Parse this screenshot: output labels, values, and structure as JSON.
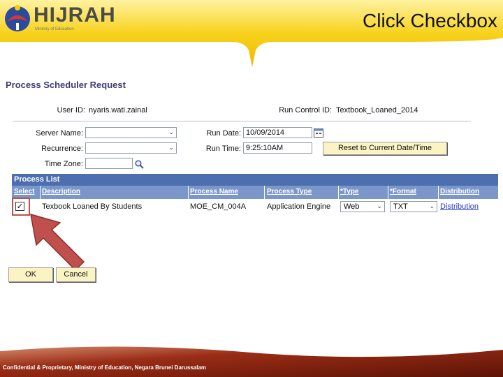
{
  "slide": {
    "title": "Click Checkbox"
  },
  "brand": {
    "logo_text": "HIJRAH",
    "logo_sub": "Ministry of Education"
  },
  "form": {
    "page_title": "Process Scheduler Request",
    "user_id_label": "User ID:",
    "user_id_value": "nyaris.wati.zainal",
    "run_control_label": "Run Control ID:",
    "run_control_value": "Textbook_Loaned_2014",
    "server_name_label": "Server Name:",
    "recurrence_label": "Recurrence:",
    "time_zone_label": "Time Zone:",
    "run_date_label": "Run Date:",
    "run_date_value": "10/09/2014",
    "run_time_label": "Run Time:",
    "run_time_value": "9:25:10AM",
    "reset_button": "Reset to Current Date/Time"
  },
  "process_list": {
    "title": "Process List",
    "columns": [
      "Select",
      "Description",
      "Process Name",
      "Process Type",
      "*Type",
      "*Format",
      "Distribution"
    ],
    "rows": [
      {
        "select": "✓",
        "description": "Texbook Loaned By Students",
        "process_name": "MOE_CM_004A",
        "process_type": "Application Engine",
        "type": "Web",
        "format": "TXT",
        "distribution": "Distribution"
      }
    ]
  },
  "actions": {
    "ok": "OK",
    "cancel": "Cancel"
  },
  "footer": {
    "text": "Confidential & Proprietary, Ministry of Education, Negara Brunei Darussalam"
  },
  "colors": {
    "banner": "#f5c400",
    "grid_header": "#4d6fb0",
    "grid_columns": "#7b97c9",
    "arrow": "#c0504d",
    "footer": "#7a1e0e"
  },
  "icons": [
    "logo-emblem-icon",
    "calendar-icon",
    "magnifier-icon",
    "chevron-down-icon",
    "checkmark-icon",
    "pointer-arrow-icon"
  ]
}
